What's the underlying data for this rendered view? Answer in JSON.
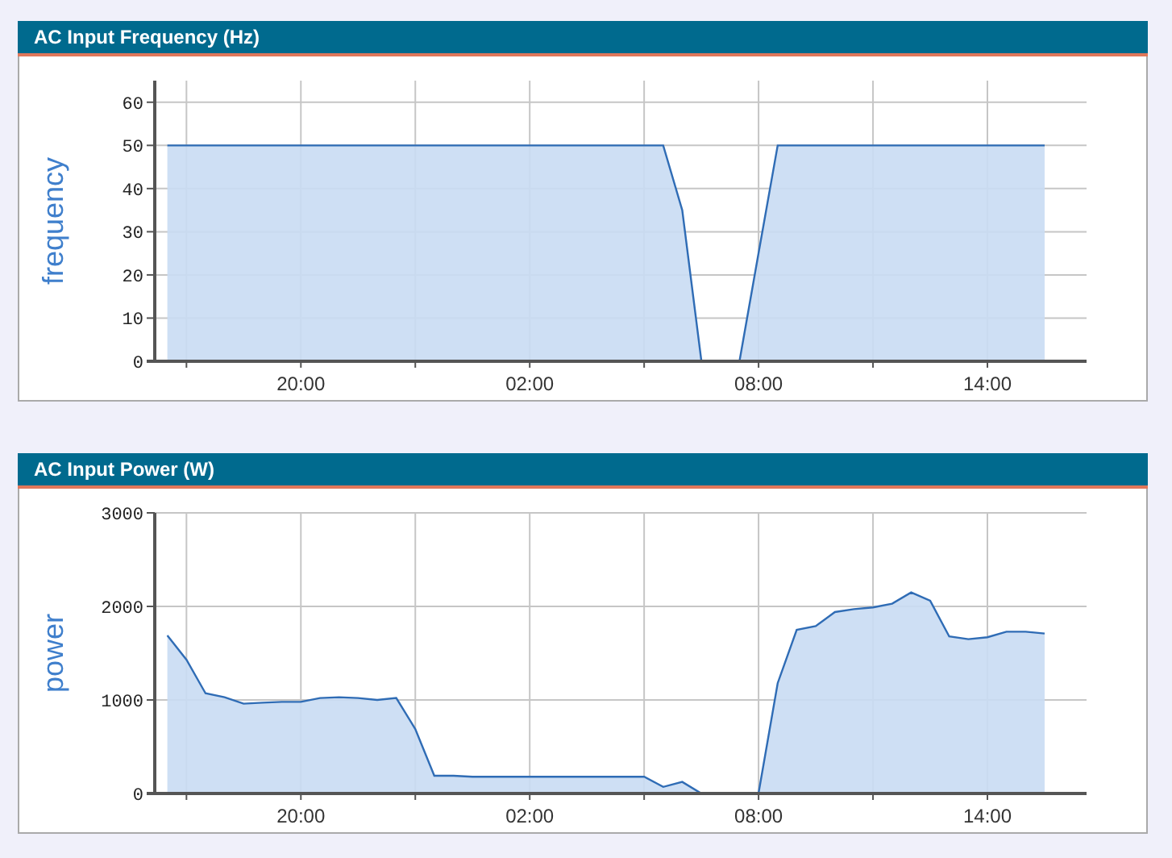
{
  "panels": [
    {
      "title": "AC Input Frequency (Hz)",
      "chart_data": {
        "type": "area",
        "grid": true,
        "ylabel": "frequency",
        "ylim": [
          0,
          65
        ],
        "yticks": [
          0,
          10,
          20,
          30,
          40,
          50,
          60
        ],
        "categories": [
          null,
          null,
          null,
          null,
          null,
          null,
          null,
          null,
          "20:00",
          null,
          null,
          null,
          null,
          null,
          null,
          null,
          null,
          null,
          null,
          null,
          "02:00",
          null,
          null,
          null,
          null,
          null,
          null,
          null,
          null,
          null,
          null,
          null,
          "08:00",
          null,
          null,
          null,
          null,
          null,
          null,
          null,
          null,
          null,
          null,
          null,
          "14:00",
          null,
          null,
          null,
          null
        ],
        "series": [
          {
            "color": "#2f6cb5",
            "values": [
              null,
              50,
              50,
              50,
              50,
              50,
              50,
              50,
              50,
              50,
              50,
              50,
              50,
              50,
              50,
              50,
              50,
              50,
              50,
              50,
              50,
              50,
              50,
              50,
              50,
              50,
              50,
              50,
              35,
              0,
              0,
              0,
              25,
              50,
              50,
              50,
              50,
              50,
              50,
              50,
              50,
              50,
              50,
              50,
              50,
              50,
              50,
              50,
              null
            ]
          }
        ]
      }
    },
    {
      "title": "AC Input Power (W)",
      "chart_data": {
        "type": "area",
        "grid": true,
        "ylabel": "power",
        "ylim": [
          0,
          3000
        ],
        "yticks": [
          0,
          1000,
          2000,
          3000
        ],
        "categories": [
          null,
          null,
          null,
          null,
          null,
          null,
          null,
          null,
          "20:00",
          null,
          null,
          null,
          null,
          null,
          null,
          null,
          null,
          null,
          null,
          null,
          "02:00",
          null,
          null,
          null,
          null,
          null,
          null,
          null,
          null,
          null,
          null,
          null,
          "08:00",
          null,
          null,
          null,
          null,
          null,
          null,
          null,
          null,
          null,
          null,
          null,
          "14:00",
          null,
          null,
          null,
          null
        ],
        "series": [
          {
            "color": "#2f6cb5",
            "values": [
              null,
              1690,
              1430,
              1070,
              1030,
              960,
              970,
              980,
              980,
              1020,
              1030,
              1020,
              1000,
              1020,
              690,
              190,
              190,
              180,
              180,
              180,
              180,
              180,
              180,
              180,
              180,
              180,
              180,
              70,
              125,
              0,
              0,
              0,
              0,
              1180,
              1750,
              1790,
              1940,
              1970,
              1990,
              2030,
              2150,
              2060,
              1680,
              1650,
              1670,
              1730,
              1730,
              1710,
              null
            ]
          }
        ]
      }
    }
  ]
}
